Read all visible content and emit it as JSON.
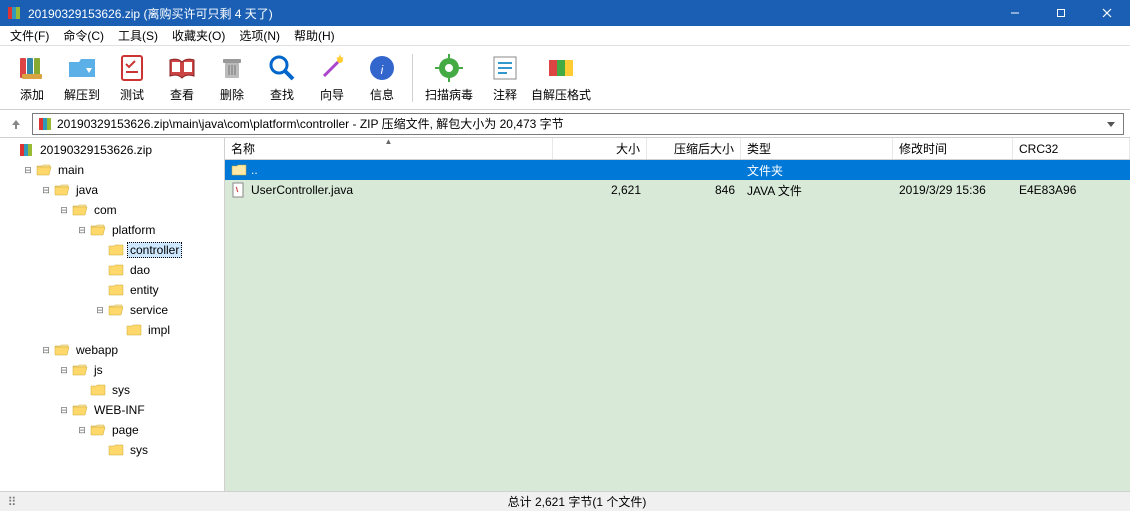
{
  "window": {
    "title": "20190329153626.zip (离购买许可只剩 4 天了)"
  },
  "menu": [
    "文件(F)",
    "命令(C)",
    "工具(S)",
    "收藏夹(O)",
    "选项(N)",
    "帮助(H)"
  ],
  "toolbar": [
    {
      "id": "add",
      "label": "添加",
      "icon": "books-icon"
    },
    {
      "id": "extract",
      "label": "解压到",
      "icon": "folder-out-icon"
    },
    {
      "id": "test",
      "label": "测试",
      "icon": "checklist-icon"
    },
    {
      "id": "view",
      "label": "查看",
      "icon": "book-open-icon"
    },
    {
      "id": "delete",
      "label": "删除",
      "icon": "trash-icon"
    },
    {
      "id": "find",
      "label": "查找",
      "icon": "search-icon"
    },
    {
      "id": "wizard",
      "label": "向导",
      "icon": "wand-icon"
    },
    {
      "id": "info",
      "label": "信息",
      "icon": "info-icon"
    },
    {
      "id": "sep",
      "label": "",
      "icon": ""
    },
    {
      "id": "virus",
      "label": "扫描病毒",
      "icon": "virus-icon",
      "wide": true
    },
    {
      "id": "comment",
      "label": "注释",
      "icon": "comment-icon"
    },
    {
      "id": "sfx",
      "label": "自解压格式",
      "icon": "sfx-icon",
      "wide": true
    }
  ],
  "address": {
    "path_text": "20190329153626.zip\\main\\java\\com\\platform\\controller - ZIP 压缩文件, 解包大小为 20,473 字节"
  },
  "tree": [
    {
      "depth": 0,
      "label": "20190329153626.zip",
      "icon": "archive",
      "toggle": ""
    },
    {
      "depth": 1,
      "label": "main",
      "icon": "folder-open",
      "toggle": "minus"
    },
    {
      "depth": 2,
      "label": "java",
      "icon": "folder-open",
      "toggle": "minus"
    },
    {
      "depth": 3,
      "label": "com",
      "icon": "folder-open",
      "toggle": "minus"
    },
    {
      "depth": 4,
      "label": "platform",
      "icon": "folder-open",
      "toggle": "minus"
    },
    {
      "depth": 5,
      "label": "controller",
      "icon": "folder",
      "toggle": "",
      "selected": true
    },
    {
      "depth": 5,
      "label": "dao",
      "icon": "folder",
      "toggle": ""
    },
    {
      "depth": 5,
      "label": "entity",
      "icon": "folder",
      "toggle": ""
    },
    {
      "depth": 5,
      "label": "service",
      "icon": "folder-open",
      "toggle": "minus"
    },
    {
      "depth": 6,
      "label": "impl",
      "icon": "folder",
      "toggle": ""
    },
    {
      "depth": 2,
      "label": "webapp",
      "icon": "folder-open",
      "toggle": "minus"
    },
    {
      "depth": 3,
      "label": "js",
      "icon": "folder-open",
      "toggle": "minus"
    },
    {
      "depth": 4,
      "label": "sys",
      "icon": "folder",
      "toggle": ""
    },
    {
      "depth": 3,
      "label": "WEB-INF",
      "icon": "folder-open",
      "toggle": "minus"
    },
    {
      "depth": 4,
      "label": "page",
      "icon": "folder-open",
      "toggle": "minus"
    },
    {
      "depth": 5,
      "label": "sys",
      "icon": "folder",
      "toggle": ""
    }
  ],
  "columns": {
    "name": "名称",
    "size": "大小",
    "csize": "压缩后大小",
    "type": "类型",
    "mtime": "修改时间",
    "crc": "CRC32"
  },
  "rows": [
    {
      "kind": "up",
      "name": "..",
      "type": "文件夹"
    },
    {
      "kind": "file",
      "name": "UserController.java",
      "size": "2,621",
      "csize": "846",
      "type": "JAVA 文件",
      "mtime": "2019/3/29 15:36",
      "crc": "E4E83A96"
    }
  ],
  "statusbar": {
    "summary": "总计 2,621 字节(1 个文件)"
  }
}
